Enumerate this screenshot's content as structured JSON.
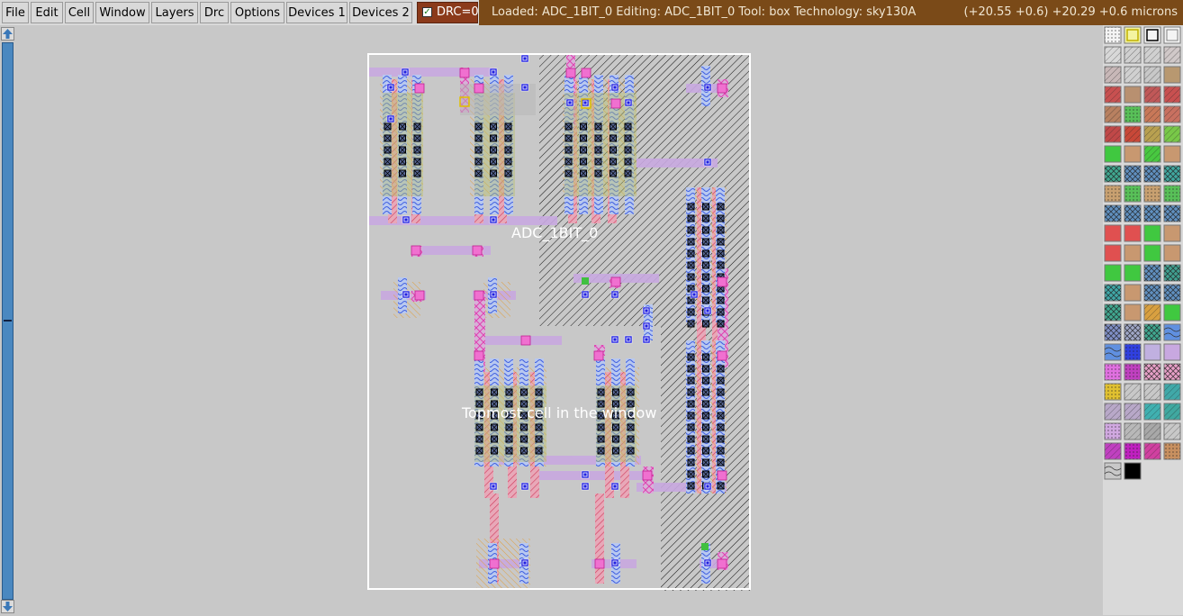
{
  "menubar": {
    "items": [
      "File",
      "Edit",
      "Cell",
      "Window",
      "Layers",
      "Drc",
      "Options",
      "Devices 1",
      "Devices 2"
    ]
  },
  "drc": {
    "label": "DRC=0",
    "checked": true
  },
  "status": {
    "message": "Loaded: ADC_1BIT_0 Editing: ADC_1BIT_0 Tool: box  Technology: sky130A",
    "coordinates": "(+20.55 +0.6) +20.29 +0.6 microns"
  },
  "layout": {
    "cell_name": "ADC_1BIT_0",
    "cell_caption": "Topmost cell in the window"
  },
  "colors": {
    "status_bg": "#7a4a18",
    "drc_bg": "#8b3a1a",
    "scroll_track": "#4a88c0",
    "canvas_bg": "#c8c8c8"
  }
}
